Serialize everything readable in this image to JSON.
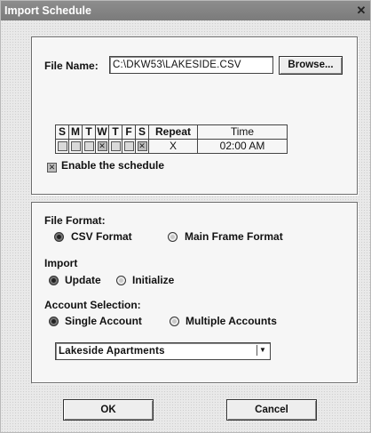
{
  "window": {
    "title": "Import Schedule"
  },
  "file": {
    "label": "File Name:",
    "value": "C:\\DKW53\\LAKESIDE.CSV",
    "browse_label": "Browse..."
  },
  "schedule": {
    "days": [
      "S",
      "M",
      "T",
      "W",
      "T",
      "F",
      "S"
    ],
    "day_checked": [
      false,
      false,
      false,
      true,
      false,
      false,
      true
    ],
    "repeat_header": "Repeat",
    "repeat_mark": "X",
    "time_header": "Time",
    "time_value": "02:00 AM"
  },
  "enable": {
    "label": "Enable the schedule",
    "checked": true
  },
  "format": {
    "label": "File Format:",
    "options": [
      {
        "label": "CSV Format",
        "selected": true
      },
      {
        "label": "Main Frame Format",
        "selected": false
      }
    ]
  },
  "import": {
    "label": "Import",
    "options": [
      {
        "label": "Update",
        "selected": true
      },
      {
        "label": "Initialize",
        "selected": false
      }
    ]
  },
  "account": {
    "label": "Account Selection:",
    "options": [
      {
        "label": "Single Account",
        "selected": true
      },
      {
        "label": "Multiple Accounts",
        "selected": false
      }
    ],
    "dropdown_value": "Lakeside Apartments"
  },
  "buttons": {
    "ok": "OK",
    "cancel": "Cancel"
  }
}
